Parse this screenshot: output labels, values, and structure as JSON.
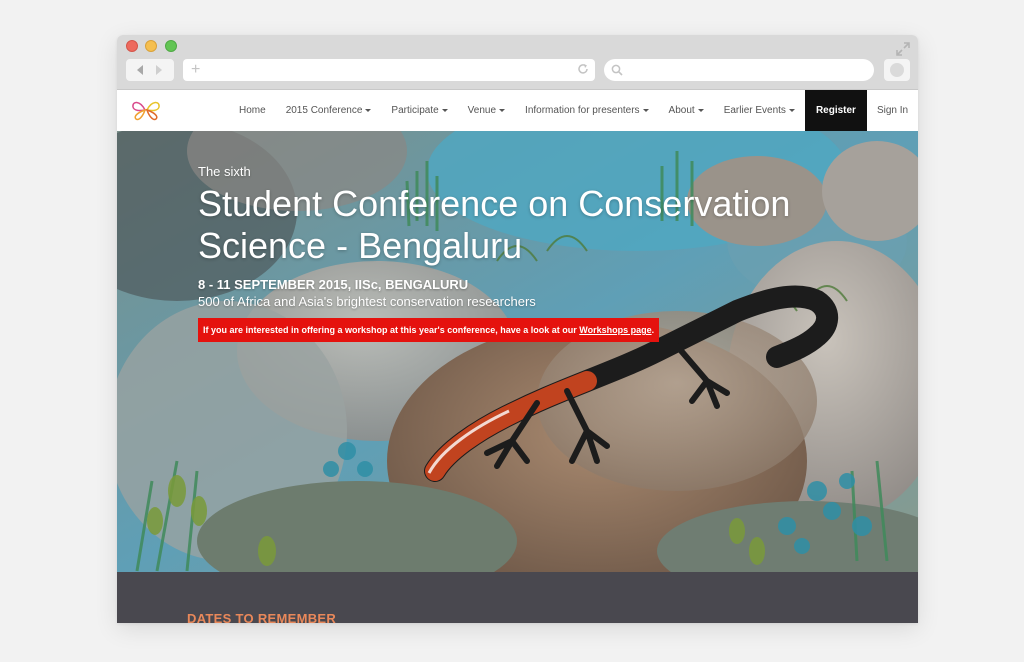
{
  "browser": {
    "url": "",
    "search_placeholder": ""
  },
  "nav": {
    "items": [
      {
        "label": "Home",
        "dropdown": false
      },
      {
        "label": "2015 Conference",
        "dropdown": true
      },
      {
        "label": "Participate",
        "dropdown": true
      },
      {
        "label": "Venue",
        "dropdown": true
      },
      {
        "label": "Information for presenters",
        "dropdown": true
      },
      {
        "label": "About",
        "dropdown": true
      },
      {
        "label": "Earlier Events",
        "dropdown": true
      }
    ],
    "register_label": "Register",
    "signin_label": "Sign In"
  },
  "hero": {
    "eyebrow": "The sixth",
    "title": "Student Conference on Conservation Science - Bengaluru",
    "dates": "8 - 11 SEPTEMBER 2015, IISc, BENGALURU",
    "tagline": "500 of Africa and Asia's brightest conservation researchers",
    "alert": {
      "text_before": "If you are interested in offering a workshop at this year's conference, have a look at our ",
      "link_text": "Workshops page",
      "text_after": "."
    }
  },
  "dates_section": {
    "heading": "DATES TO REMEMBER"
  },
  "colors": {
    "register_bg": "#111111",
    "alert_bg": "#e5120e",
    "dates_heading": "#e9885a",
    "dates_section_bg": "#49484f"
  },
  "icons": [
    "close-dot",
    "minimize-dot",
    "zoom-dot",
    "expand-icon",
    "back-arrow-icon",
    "forward-arrow-icon",
    "plus-icon",
    "reload-icon",
    "search-icon",
    "butterfly-logo"
  ]
}
